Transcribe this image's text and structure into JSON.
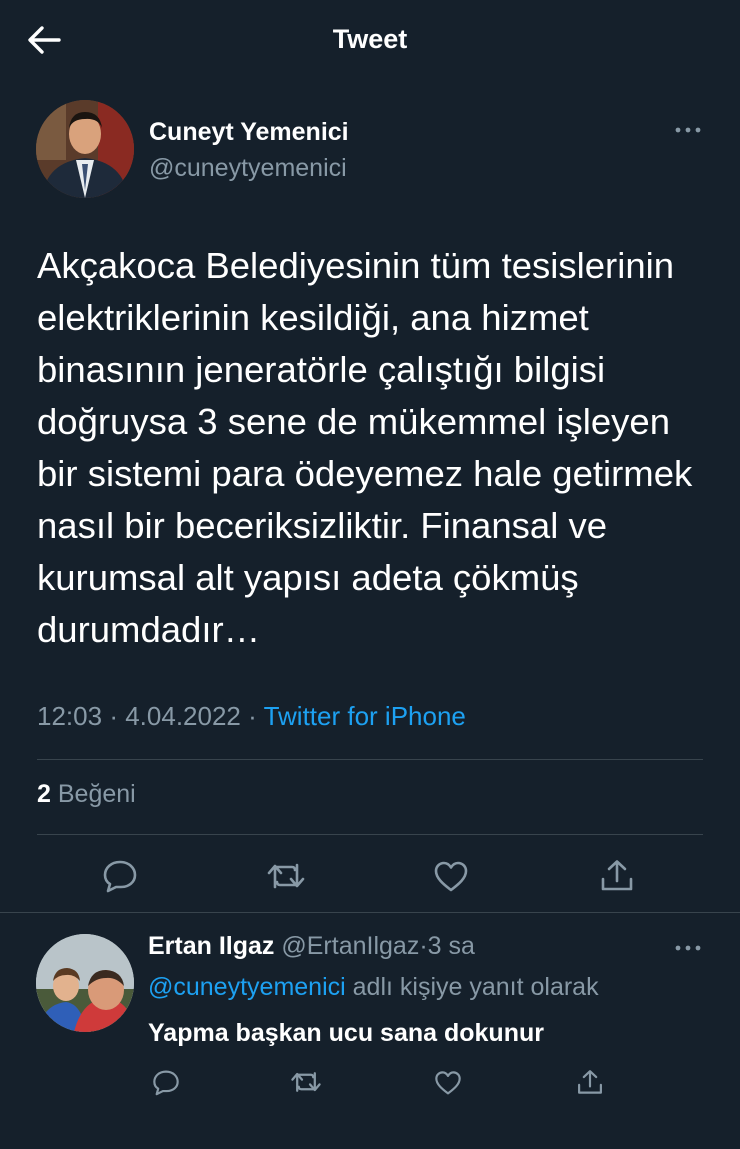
{
  "header": {
    "title": "Tweet"
  },
  "tweet": {
    "author_name": "Cuneyt Yemenici",
    "author_handle": "@cuneytyemenici",
    "text": "Akçakoca Belediyesinin tüm tesislerinin elektriklerinin kesildiği, ana hizmet binasının jeneratörle çalıştığı bilgisi doğruysa 3 sene de mükemmel işleyen bir sistemi para ödeyemez hale getirmek nasıl bir beceriksizliktir. Finansal ve kurumsal alt yapısı adeta çökmüş durumdadır…",
    "time": "12:03",
    "separator": "·",
    "date": "4.04.2022",
    "source": "Twitter for iPhone",
    "likes_count": "2",
    "likes_label": "Beğeni"
  },
  "reply": {
    "author_name": "Ertan Ilgaz",
    "author_handle": "@ErtanIlgaz",
    "separator": "·",
    "time_ago": "3 sa",
    "reply_to_handle": "@cuneytyemenici",
    "reply_to_suffix": " adlı kişiye yanıt olarak",
    "text": "Yapma başkan ucu sana dokunur"
  },
  "icons": {
    "back": "arrow-left-icon",
    "more": "more-dots-icon",
    "reply": "reply-bubble-icon",
    "retweet": "retweet-icon",
    "like": "heart-icon",
    "share": "share-icon"
  },
  "colors": {
    "background": "#15202b",
    "text_primary": "#ffffff",
    "text_secondary": "#8899a6",
    "accent": "#1da1f2",
    "divider": "#38444d"
  }
}
